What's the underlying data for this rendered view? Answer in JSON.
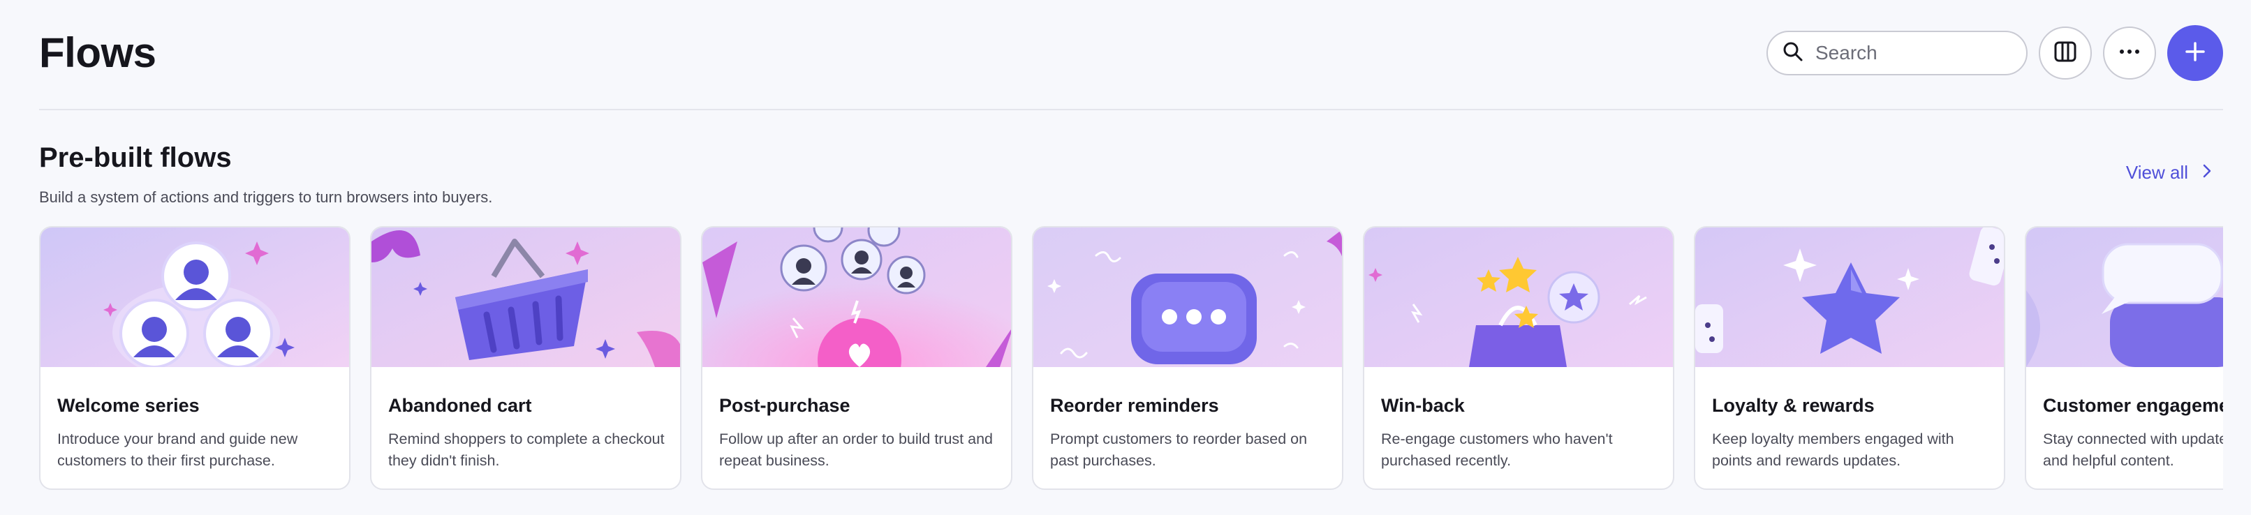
{
  "header": {
    "title": "Flows"
  },
  "toolbar": {
    "search_placeholder": "Search",
    "icons": {
      "search": "search-icon",
      "columns": "columns-icon",
      "more": "more-horizontal-icon",
      "add": "plus-icon"
    }
  },
  "section": {
    "title": "Pre-built flows",
    "subtitle": "Build a system of actions and triggers to turn browsers into buyers.",
    "view_all": "View all"
  },
  "cards": [
    {
      "title": "Welcome series",
      "description": "Introduce your brand and guide new customers to their first purchase.",
      "illustration": "people-icon"
    },
    {
      "title": "Abandoned cart",
      "description": "Remind shoppers to complete a checkout they didn't finish.",
      "illustration": "basket-icon"
    },
    {
      "title": "Post-purchase",
      "description": "Follow up after an order to build trust and repeat business.",
      "illustration": "heart-icon"
    },
    {
      "title": "Reorder reminders",
      "description": "Prompt customers to reorder based on past purchases.",
      "illustration": "chat-bubble-icon"
    },
    {
      "title": "Win-back",
      "description": "Re-engage customers who haven't purchased recently.",
      "illustration": "shopping-bag-icon"
    },
    {
      "title": "Loyalty & rewards",
      "description": "Keep loyalty members engaged with points and rewards updates.",
      "illustration": "star-icon"
    },
    {
      "title": "Customer engagement",
      "description": "Stay connected with updates, launches, and helpful content.",
      "illustration": "speech-bubbles-icon"
    }
  ],
  "colors": {
    "accent": "#5b5bea",
    "link": "#4f4fd9",
    "background": "#f7f8fc"
  }
}
